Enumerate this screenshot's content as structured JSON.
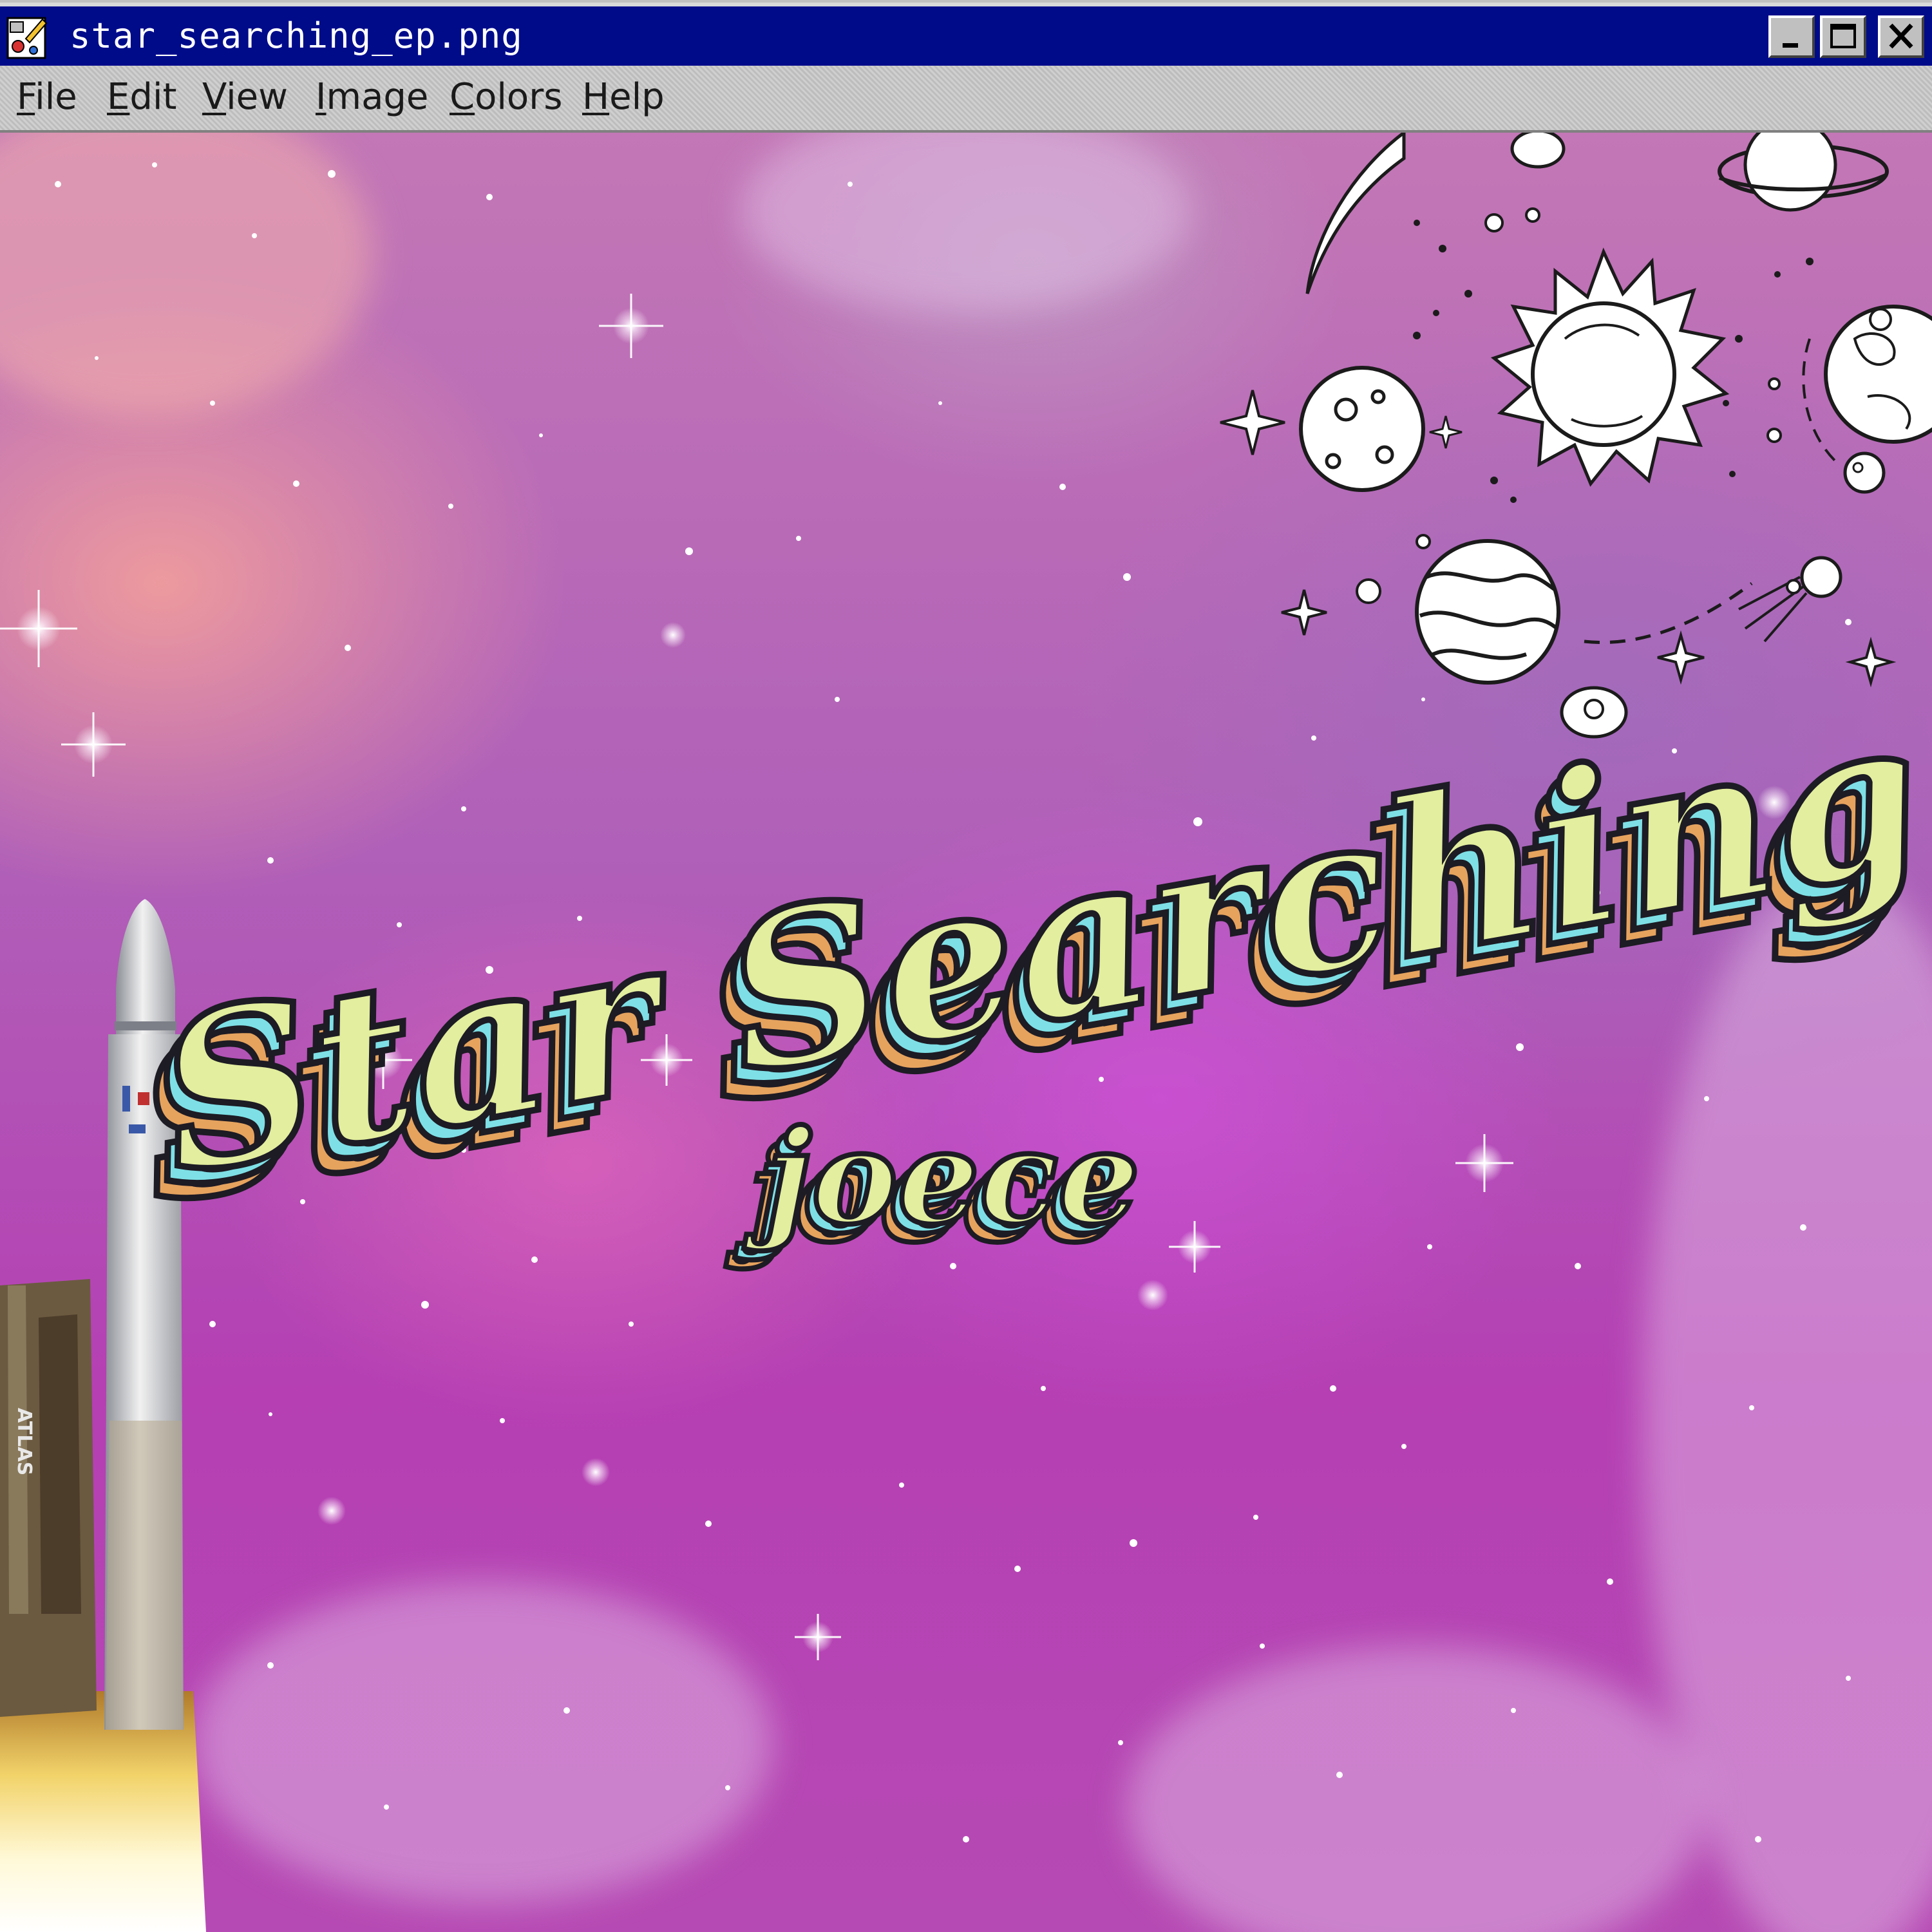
{
  "window": {
    "title": "star_searching_ep.png",
    "icon": "paint-icon"
  },
  "window_controls": {
    "minimize_icon": "minimize-icon",
    "maximize_icon": "maximize-icon",
    "close_icon": "close-icon"
  },
  "menu": {
    "items": [
      {
        "label_u": "F",
        "label_rest": "ile"
      },
      {
        "label_u": "E",
        "label_rest": "dit"
      },
      {
        "label_u": "V",
        "label_rest": "iew"
      },
      {
        "label_u": "I",
        "label_rest": "mage"
      },
      {
        "label_u": "C",
        "label_rest": "olors"
      },
      {
        "label_u": "H",
        "label_rest": "elp"
      }
    ]
  },
  "artwork": {
    "title": "Star Searching",
    "artist": "joece",
    "rocket_label": "ATLAS",
    "palette": {
      "text_fill": "#e3ee9e",
      "text_outline": "#1d1b24",
      "shadow_cyan": "#7ee0e6",
      "shadow_orange": "#e6a35e",
      "sky_pink": "#e07ab8",
      "sky_purple": "#b049b8"
    }
  }
}
